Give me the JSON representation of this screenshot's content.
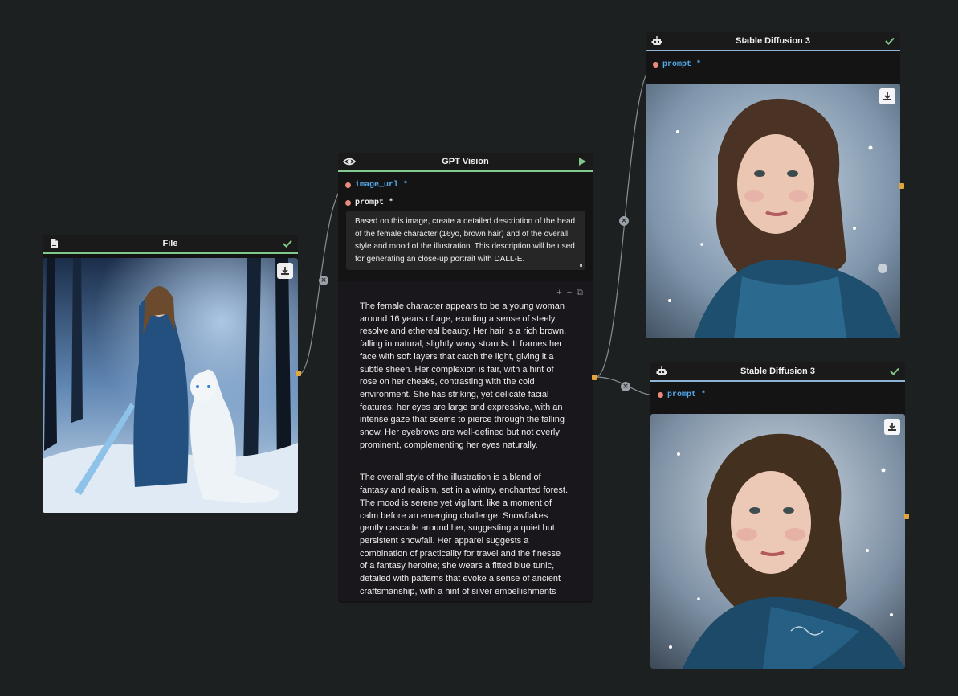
{
  "file_node": {
    "title": "File",
    "header_icon": "file-icon",
    "status_icon": "check-icon",
    "download_icon": "download-icon"
  },
  "gpt_node": {
    "title": "GPT Vision",
    "header_icon": "eye-icon",
    "run_icon": "play-icon",
    "inputs": [
      {
        "label": "image_url",
        "required": "*"
      },
      {
        "label": "prompt",
        "required": "*"
      }
    ],
    "prompt_text": "Based on this image, create a detailed description of the head of the female character (16yo, brown hair) and of the overall style and mood of the illustration. This description will be used for generating an close-up portrait with DALL-E.",
    "output_tools": [
      "+",
      "−",
      "⧉"
    ],
    "output_paragraphs": [
      "The female character appears to be a young woman around 16 years of age, exuding a sense of steely resolve and ethereal beauty. Her hair is a rich brown, falling in natural, slightly wavy strands. It frames her face with soft layers that catch the light, giving it a subtle sheen. Her complexion is fair, with a hint of rose on her cheeks, contrasting with the cold environment. She has striking, yet delicate facial features; her eyes are large and expressive, with an intense gaze that seems to pierce through the falling snow. Her eyebrows are well-defined but not overly prominent, complementing her eyes naturally.",
      "The overall style of the illustration is a blend of fantasy and realism, set in a wintry, enchanted forest. The mood is serene yet vigilant, like a moment of calm before an emerging challenge. Snowflakes gently cascade around her, suggesting a quiet but persistent snowfall. Her apparel suggests a combination of practicality for travel and the finesse of a fantasy heroine; she wears a fitted blue tunic, detailed with patterns that evoke a sense of ancient craftsmanship, with a hint of silver embellishments"
    ]
  },
  "sd_nodes": [
    {
      "title": "Stable Diffusion 3",
      "header_icon": "robot-icon",
      "status_icon": "check-icon",
      "input_label": "prompt",
      "required": "*"
    },
    {
      "title": "Stable Diffusion 3",
      "header_icon": "robot-icon",
      "status_icon": "check-icon",
      "input_label": "prompt",
      "required": "*"
    }
  ],
  "connector_close_glyph": "×",
  "colors": {
    "canvas": "#1c2020",
    "node_bg": "#141414",
    "accent_green": "#7ac29a",
    "port_orange": "#e3a53a",
    "port_dot": "#e98b7c",
    "mono_blue": "#52a8e8"
  }
}
